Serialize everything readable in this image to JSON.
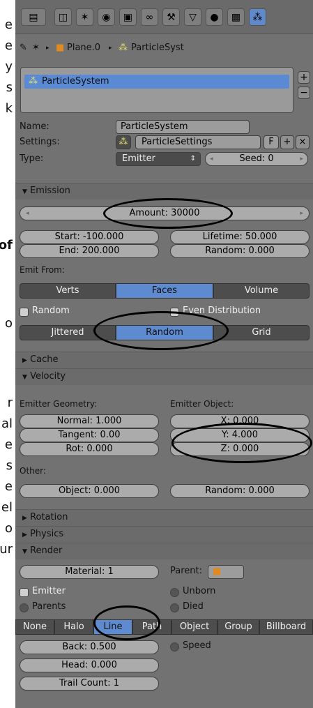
{
  "doc": {
    "lines": [
      {
        "text": "e",
        "bold": false
      },
      {
        "text": "e",
        "bold": false
      },
      {
        "text": "y",
        "bold": false
      },
      {
        "text": "s",
        "bold": false
      },
      {
        "text": "k",
        "bold": false
      },
      {
        "text": "of",
        "bold": true
      },
      {
        "text": "o",
        "bold": false
      },
      {
        "text": "r",
        "bold": false
      },
      {
        "text": "al",
        "bold": false
      },
      {
        "text": "e",
        "bold": false
      },
      {
        "text": "s",
        "bold": false
      },
      {
        "text": "e",
        "bold": false
      },
      {
        "text": "el",
        "bold": false
      },
      {
        "text": "o",
        "bold": false
      },
      {
        "text": "ur",
        "bold": false
      }
    ]
  },
  "header": {
    "icons": [
      "menu-toggle-icon",
      "render-icon",
      "scene-icon",
      "world-icon",
      "object-icon",
      "constraints-icon",
      "modifier-icon",
      "mesh-data-icon",
      "material-icon",
      "texture-icon",
      "particles-icon"
    ]
  },
  "breadcrumb": {
    "object": "Plane.0",
    "system": "ParticleSyst"
  },
  "list": {
    "item": "ParticleSystem",
    "add": "+",
    "remove": "−"
  },
  "props": {
    "name_label": "Name:",
    "name_value": "ParticleSystem",
    "settings_label": "Settings:",
    "settings_value": "ParticleSettings",
    "settings_f": "F",
    "type_label": "Type:",
    "type_value": "Emitter",
    "seed": "Seed: 0"
  },
  "emission": {
    "title": "Emission",
    "amount": "Amount: 30000",
    "start": "Start: -100.000",
    "end": "End: 200.000",
    "lifetime": "Lifetime: 50.000",
    "random": "Random: 0.000",
    "emit_from": "Emit From:",
    "verts": "Verts",
    "faces": "Faces",
    "volume": "Volume",
    "random_chk": "Random",
    "even": "Even Distribution",
    "jittered": "Jittered",
    "random_btn": "Random",
    "grid": "Grid"
  },
  "cache": {
    "title": "Cache"
  },
  "velocity": {
    "title": "Velocity",
    "geom": "Emitter Geometry:",
    "obj": "Emitter Object:",
    "normal": "Normal: 1.000",
    "tangent": "Tangent: 0.00",
    "rot": "Rot: 0.000",
    "x": "X: 0.000",
    "y": "Y: 4.000",
    "z": "Z: 0.000",
    "other": "Other:",
    "object": "Object: 0.000",
    "random": "Random: 0.000"
  },
  "sections": {
    "rotation": "Rotation",
    "physics": "Physics"
  },
  "render": {
    "title": "Render",
    "material": "Material: 1",
    "parent": "Parent:",
    "emitter": "Emitter",
    "unborn": "Unborn",
    "parents": "Parents",
    "died": "Died",
    "tabs": [
      "None",
      "Halo",
      "Line",
      "Path",
      "Object",
      "Group",
      "Billboard"
    ],
    "back": "Back: 0.500",
    "speed": "Speed",
    "head": "Head: 0.000",
    "trail": "Trail Count: 1"
  },
  "colors": {
    "panel": "#727272",
    "accent": "#5e8ad0",
    "dark_button": "#4b4b4b"
  }
}
